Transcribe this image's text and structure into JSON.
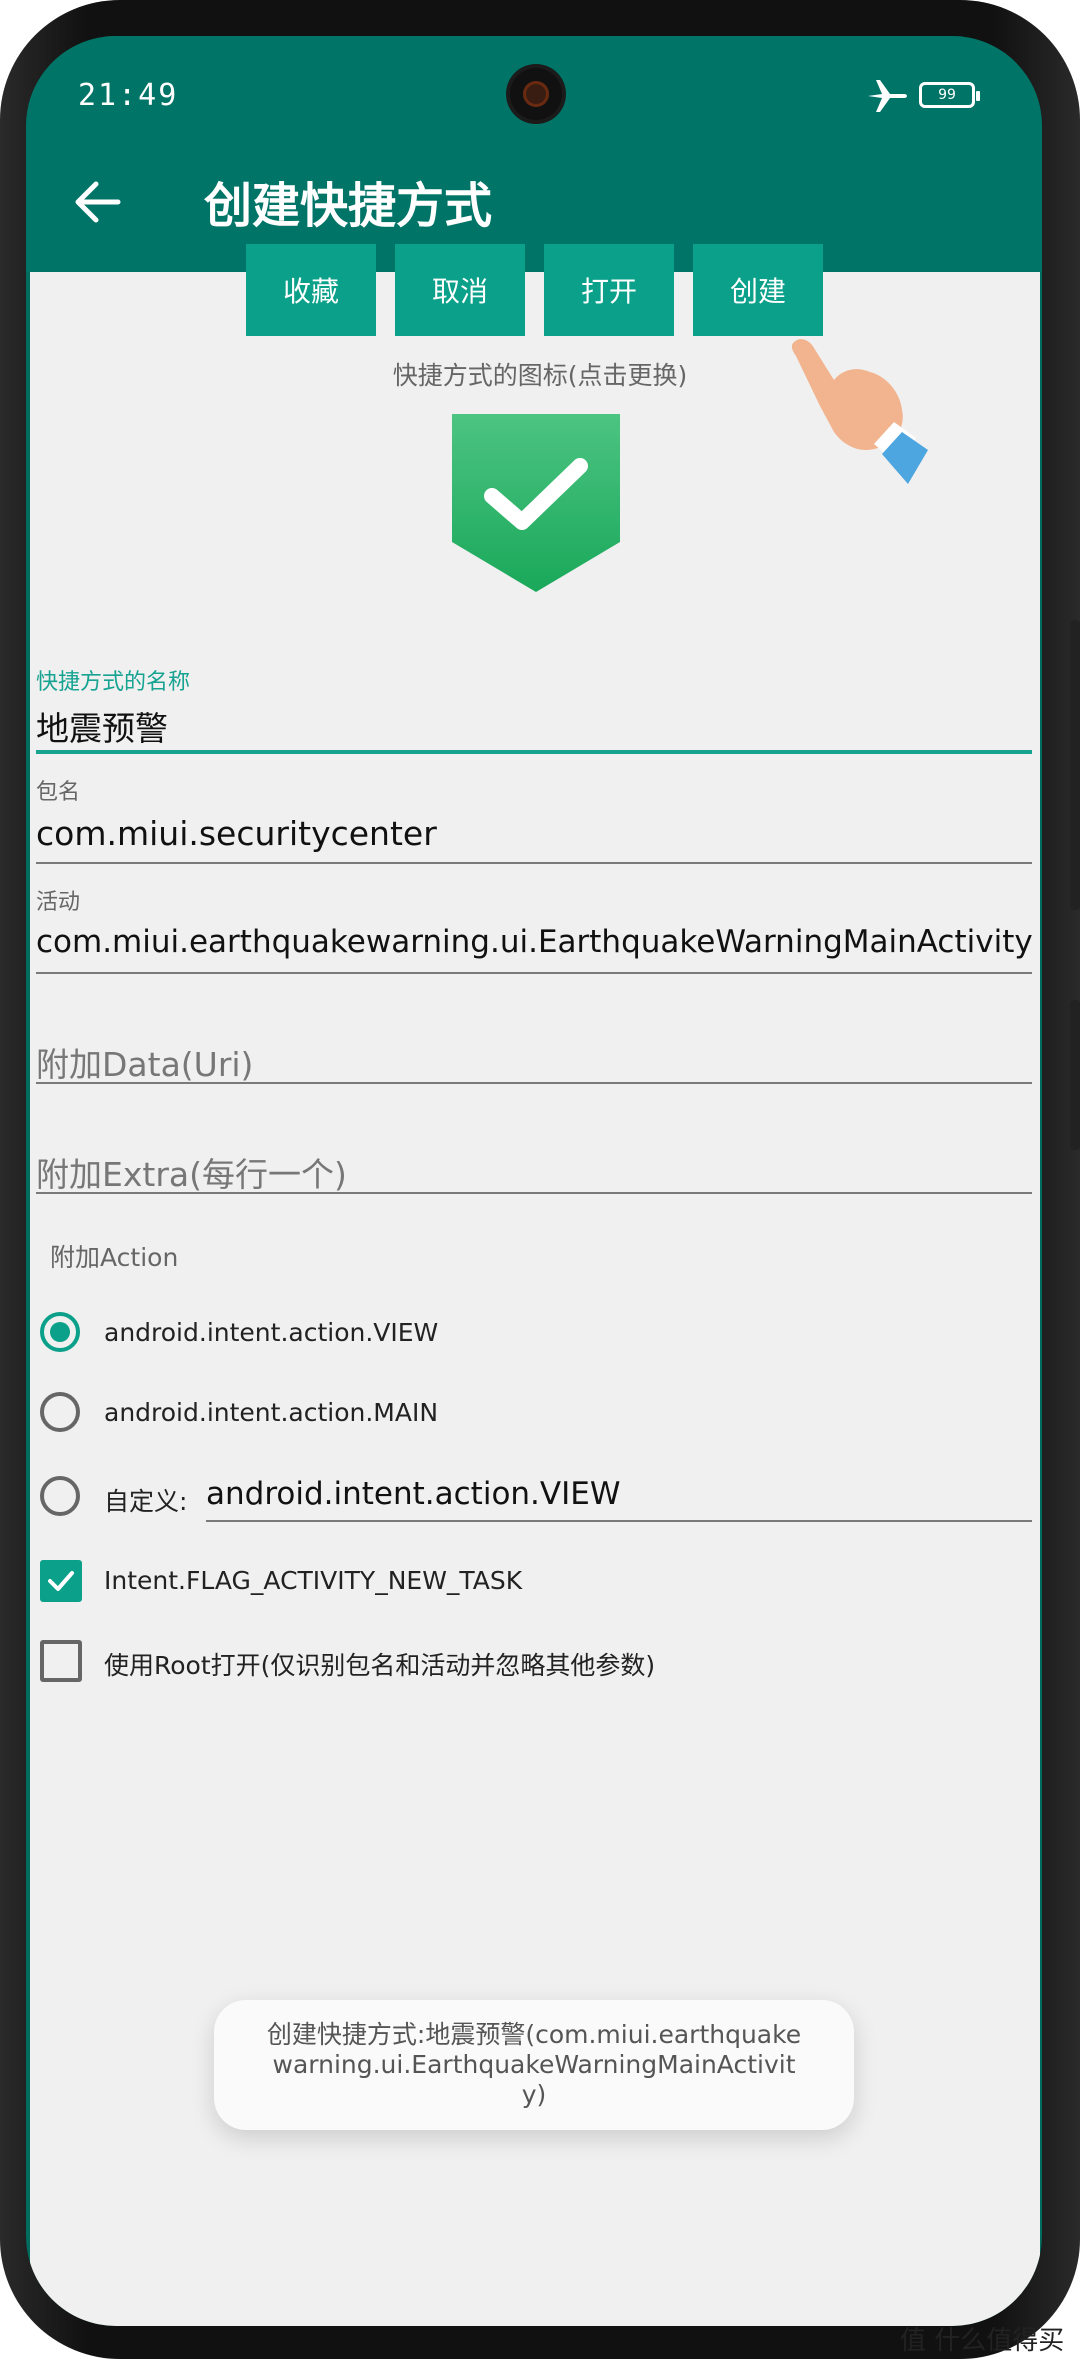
{
  "status": {
    "time": "21:49",
    "battery": "99"
  },
  "appbar": {
    "title": "创建快捷方式"
  },
  "buttons": {
    "favorite": "收藏",
    "cancel": "取消",
    "open": "打开",
    "create": "创建"
  },
  "icon_hint": "快捷方式的图标(点击更换)",
  "fields": {
    "name_label": "快捷方式的名称",
    "name_value": "地震预警",
    "package_label": "包名",
    "package_value": "com.miui.securitycenter",
    "activity_label": "活动",
    "activity_value": "com.miui.earthquakewarning.ui.EarthquakeWarningMainActivity",
    "data_placeholder": "附加Data(Uri)",
    "extra_placeholder": "附加Extra(每行一个)"
  },
  "action": {
    "label": "附加Action",
    "options": [
      "android.intent.action.VIEW",
      "android.intent.action.MAIN"
    ],
    "custom_label": "自定义:",
    "custom_value": "android.intent.action.VIEW",
    "selected": "android.intent.action.VIEW"
  },
  "checkboxes": {
    "new_task": "Intent.FLAG_ACTIVITY_NEW_TASK",
    "root_open": "使用Root打开(仅识别包名和活动并忽略其他参数)"
  },
  "toast": "创建快捷方式:地震预警(com.miui.earthquakewarning.ui.EarthquakeWarningMainActivity)",
  "watermark": "值 什么值得买",
  "colors": {
    "toolbar": "#007466",
    "accent": "#0aa089",
    "background": "#f0f0f0"
  }
}
